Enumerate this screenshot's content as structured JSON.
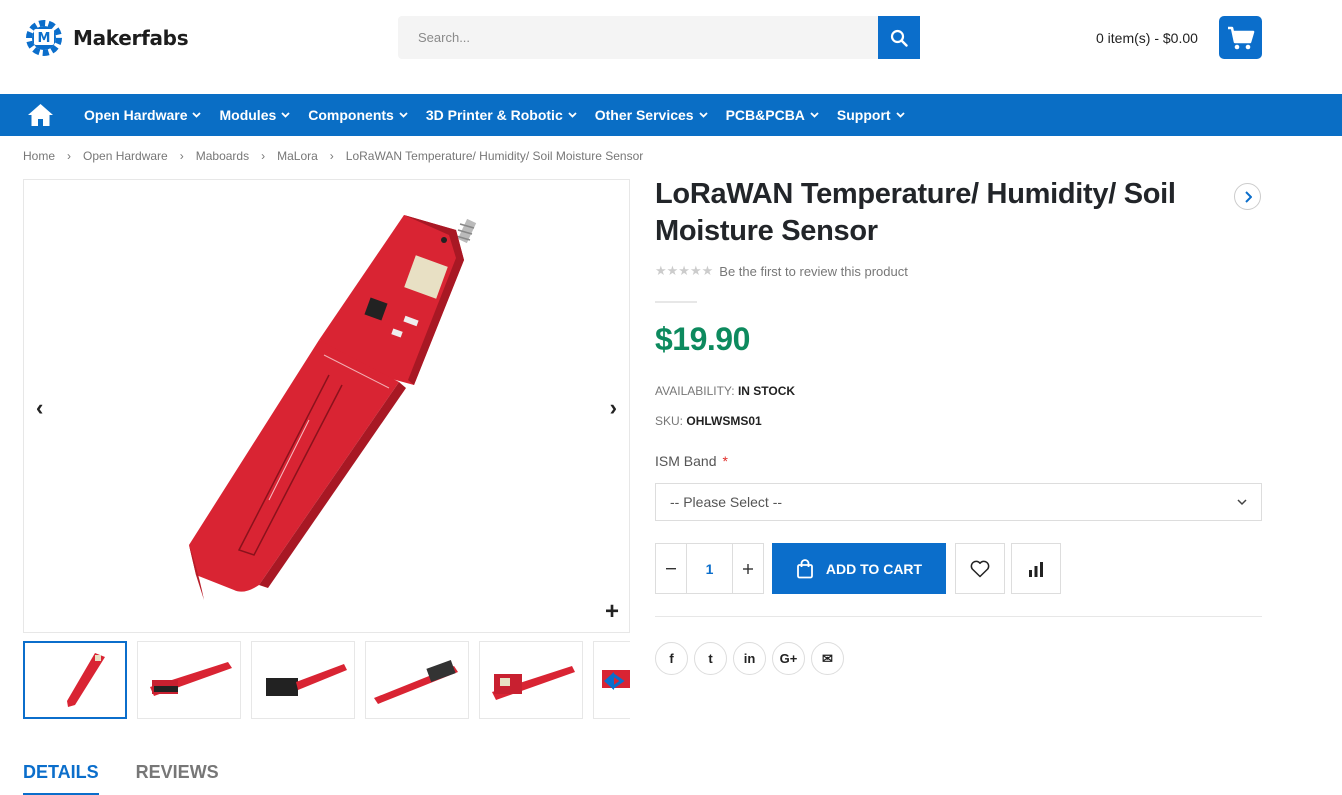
{
  "header": {
    "logo_text": "Makerfabs",
    "search_placeholder": "Search...",
    "cart_summary": "0 item(s) - $0.00"
  },
  "nav": {
    "items": [
      {
        "label": "Open Hardware"
      },
      {
        "label": "Modules"
      },
      {
        "label": "Components"
      },
      {
        "label": "3D Printer & Robotic"
      },
      {
        "label": "Other Services"
      },
      {
        "label": "PCB&PCBA"
      },
      {
        "label": "Support"
      }
    ]
  },
  "breadcrumb": [
    "Home",
    "Open Hardware",
    "Maboards",
    "MaLora",
    "LoRaWAN Temperature/ Humidity/ Soil Moisture Sensor"
  ],
  "product": {
    "title": "LoRaWAN Temperature/ Humidity/ Soil Moisture Sensor",
    "rating_text": "Be the first to review this product",
    "stars": "★★★★★",
    "price": "$19.90",
    "availability_label": "AVAILABILITY:",
    "availability_value": "IN STOCK",
    "sku_label": "SKU:",
    "sku_value": "OHLWSMS01",
    "option_label": "ISM Band",
    "option_required": "*",
    "option_selected": "-- Please Select --",
    "quantity": "1",
    "add_to_cart_label": "ADD TO CART"
  },
  "gallery": {
    "zoom_label": "+"
  },
  "tabs": [
    {
      "label": "DETAILS"
    },
    {
      "label": "REVIEWS"
    }
  ],
  "social": [
    "f",
    "t",
    "in",
    "G+",
    "✉"
  ],
  "colors": {
    "brand_blue": "#0b6ecb",
    "price_green": "#0d8a5e",
    "pcb_red": "#d92433"
  }
}
